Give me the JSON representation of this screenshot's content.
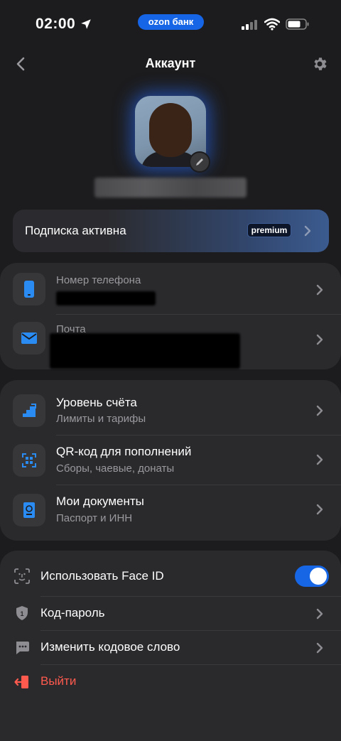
{
  "status_bar": {
    "time": "02:00",
    "bank_pill": "ozon банк"
  },
  "nav": {
    "title": "Аккаунт"
  },
  "profile": {
    "name": "Masked name"
  },
  "subscription": {
    "label": "Подписка активна",
    "badge": "premium"
  },
  "contacts": [
    {
      "label": "Номер телефона",
      "icon": "phone-icon"
    },
    {
      "label": "Почта",
      "icon": "mail-icon"
    }
  ],
  "account_items": [
    {
      "title": "Уровень счёта",
      "subtitle": "Лимиты и тарифы",
      "icon": "stairs-icon"
    },
    {
      "title": "QR-код для пополнений",
      "subtitle": "Сборы, чаевые, донаты",
      "icon": "qr-code-icon"
    },
    {
      "title": "Мои документы",
      "subtitle": "Паспорт и ИНН",
      "icon": "passport-icon"
    }
  ],
  "security_items": [
    {
      "title": "Использовать Face ID",
      "icon": "face-id-icon",
      "toggle": true
    },
    {
      "title": "Код-пароль",
      "icon": "shield-icon"
    },
    {
      "title": "Изменить кодовое слово",
      "icon": "chat-dots-icon"
    },
    {
      "title": "Выйти",
      "icon": "logout-icon"
    }
  ],
  "colors": {
    "accent": "#1666e6",
    "background": "#1c1c1e",
    "card": "#2a2a2d",
    "danger": "#ff5a4e",
    "icon_blue": "#2a8bf2"
  }
}
